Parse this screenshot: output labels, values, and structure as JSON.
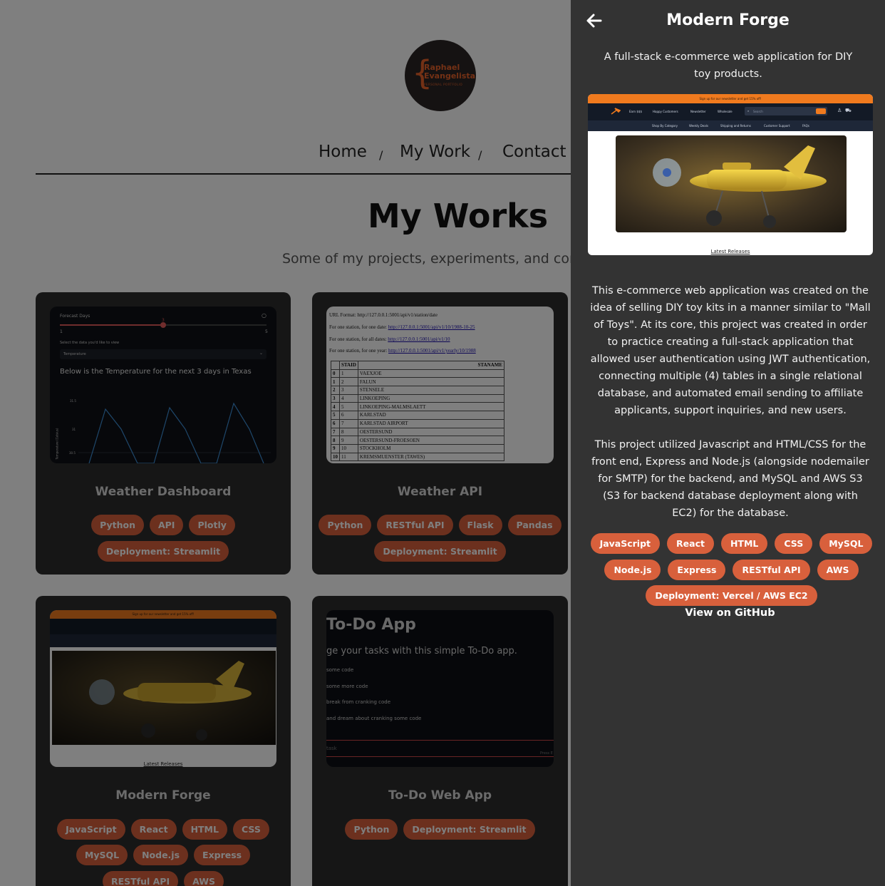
{
  "logo": {
    "line1": "Raphael",
    "line2": "Evangelista",
    "line3": "PERSONAL PORTFOLIO",
    "brace": "{"
  },
  "nav": {
    "home": "Home",
    "my_work": "My Work",
    "contact": "Contact",
    "sep": "/"
  },
  "page": {
    "title": "My Works",
    "subtitle": "Some of my projects, experiments, and contribut"
  },
  "cards": [
    {
      "title": "Weather Dashboard",
      "tags_row1": [
        "Python",
        "API",
        "Plotly"
      ],
      "tags_row2": [
        "Deployment: Streamlit"
      ],
      "shot": {
        "forecast_label": "Forecast Days",
        "slider_value": "3",
        "slider_min": "1",
        "slider_max": "5",
        "select_label": "Select the data you'd like to view",
        "select_value": "Temperature",
        "heading": "Below is the Temperature for the next 3 days in Texas",
        "ytick1": "31.5",
        "ytick2": "31",
        "ytick3": "30.5",
        "ylabel": "Temperature (Celsius)"
      }
    },
    {
      "title": "Weather API",
      "tags_row1": [
        "Python",
        "RESTful API",
        "Flask",
        "Pandas"
      ],
      "tags_row2": [
        "Deployment: Streamlit"
      ],
      "shot": {
        "line1_text": "URL Format: http://127.0.0.1:5001/api/v1/station/date",
        "line2_text": "For one station, for one date: ",
        "line2_link": "http://127.0.0.1:5001/api/v1/10/1988-10-25",
        "line3_text": "For one station, for all dates: ",
        "line3_link": "http://127.0.0.1:5001/api/v1/10",
        "line4_text": "For one station, for one year: ",
        "line4_link": "http://127.0.0.1:5001/api/v1/yearly/10/1988",
        "col_staid": "STAID",
        "col_staname": "STANAME",
        "rows": [
          [
            "0",
            "1",
            "VAEXJOE"
          ],
          [
            "1",
            "2",
            "FALUN"
          ],
          [
            "2",
            "3",
            "STENSELE"
          ],
          [
            "3",
            "4",
            "LINKOEPING"
          ],
          [
            "4",
            "5",
            "LINKOEPING-MALMSLAETT"
          ],
          [
            "5",
            "6",
            "KARLSTAD"
          ],
          [
            "6",
            "7",
            "KARLSTAD AIRPORT"
          ],
          [
            "7",
            "8",
            "OESTERSUND"
          ],
          [
            "8",
            "9",
            "OESTERSUND-FROESOEN"
          ],
          [
            "9",
            "10",
            "STOCKHOLM"
          ],
          [
            "10",
            "11",
            "KREMSMUENSTER (TAWES)"
          ]
        ]
      }
    },
    {
      "title": "Modern Forge",
      "tags_row1": [
        "JavaScript",
        "React",
        "HTML",
        "CSS"
      ],
      "tags_row2": [
        "MySQL",
        "Node.js",
        "Express"
      ],
      "tags_row3": [
        "RESTful API",
        "AWS"
      ]
    },
    {
      "title": "To-Do Web App",
      "tags_row1": [
        "Python",
        "Deployment: Streamlit"
      ],
      "shot": {
        "heading": "To-Do App",
        "subheading": "ge your tasks with this simple To-Do app.",
        "items": [
          "some code",
          "some more code",
          "break from cranking code",
          "and dream about cranking some code"
        ],
        "input_placeholder": "task",
        "press_hint": "Press E"
      }
    }
  ],
  "shop": {
    "banner": "Sign up for our newsletter and get 15% off!",
    "nav_items": [
      "Earn $$$",
      "Happy Customers",
      "Newsletter",
      "Wholesale"
    ],
    "search_placeholder": "Search",
    "sub_items": [
      "Shop By Category",
      "Weekly Deals",
      "Shipping and Returns",
      "Customer Support",
      "FAQs"
    ],
    "latest": "Latest Releases"
  },
  "panel": {
    "title": "Modern Forge",
    "summary": "A full-stack e-commerce web application for DIY toy products.",
    "paragraph1": "This e-commerce web application was created on the idea of selling DIY toy kits in a manner similar to \"Mall of Toys\". At its core, this project was created in order to practice creating a full-stack application that allowed user authentication using JWT authentication, connecting multiple (4) tables in a single relational database, and automated email sending to affiliate applicants, support inquiries, and new users.",
    "paragraph2": "This project utilized Javascript and HTML/CSS for the front end, Express and Node.js (alongside nodemailer for SMTP) for the backend, and MySQL and AWS S3 (S3 for backend database deployment along with EC2) for the database.",
    "tags_row1": [
      "JavaScript",
      "React",
      "HTML",
      "CSS",
      "MySQL"
    ],
    "tags_row2": [
      "Node.js",
      "Express",
      "RESTful API",
      "AWS"
    ],
    "tags_row3": [
      "Deployment: Vercel / AWS EC2"
    ],
    "github": "View on GitHub"
  },
  "colors": {
    "accent": "#d8603c",
    "panel_bg": "#333333",
    "card_bg": "#2c2c2c",
    "brand_orange": "#f07a1e"
  },
  "icons": {
    "back": "arrow-left-icon"
  }
}
